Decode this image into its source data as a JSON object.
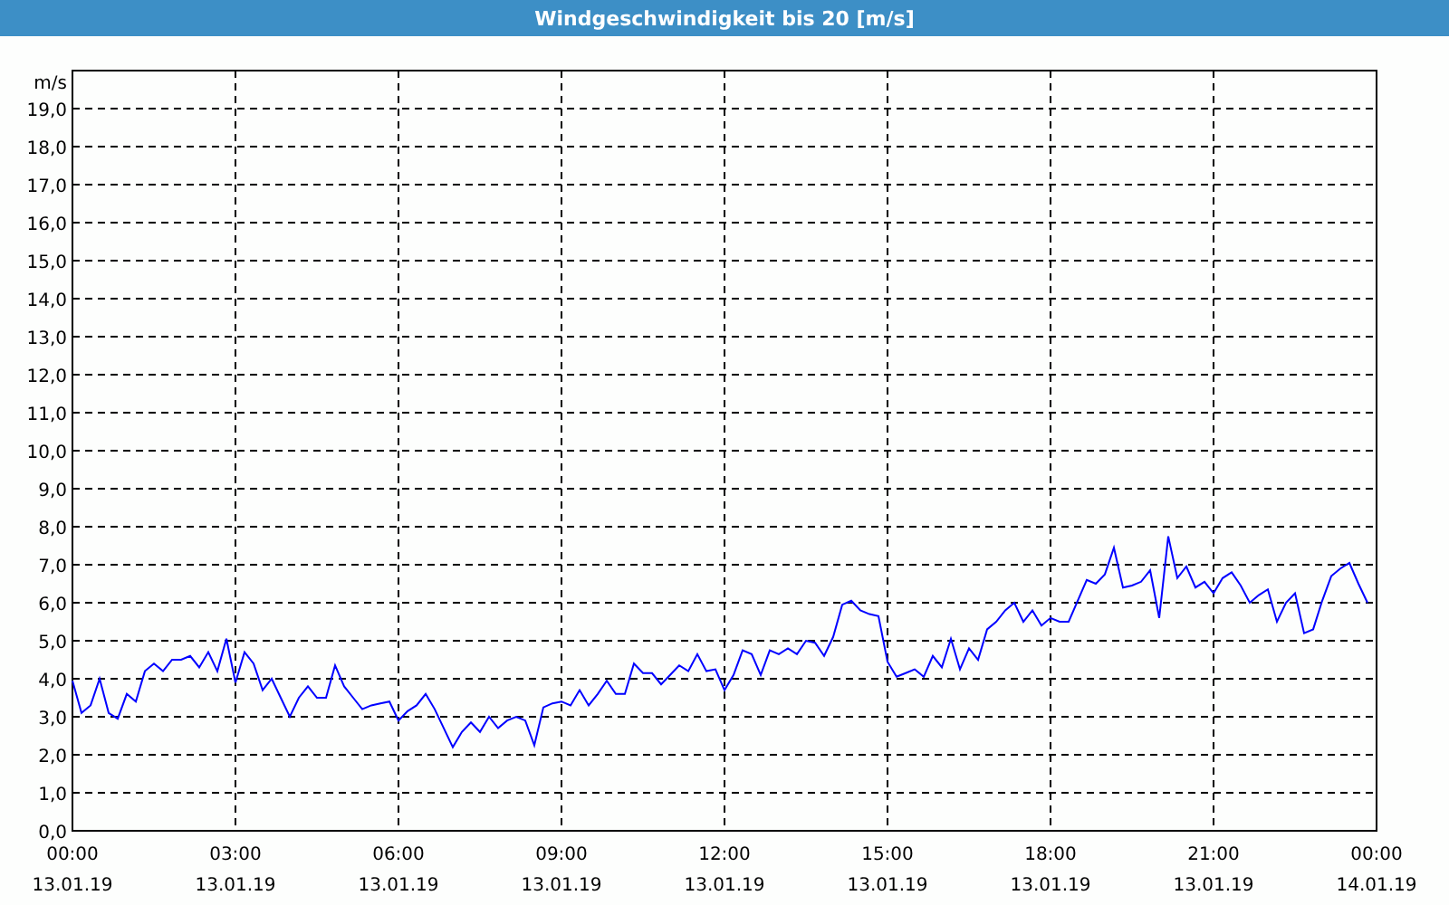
{
  "window": {
    "title": "Windgeschwindigkeit bis 20 [m/s]"
  },
  "chart": {
    "chart_data": {
      "type": "line",
      "grid": true,
      "ylabel": "m/s",
      "ylim": [
        0,
        20
      ],
      "yticks": [
        {
          "value": 0,
          "label": "0,0"
        },
        {
          "value": 1,
          "label": "1,0"
        },
        {
          "value": 2,
          "label": "2,0"
        },
        {
          "value": 3,
          "label": "3,0"
        },
        {
          "value": 4,
          "label": "4,0"
        },
        {
          "value": 5,
          "label": "5,0"
        },
        {
          "value": 6,
          "label": "6,0"
        },
        {
          "value": 7,
          "label": "7,0"
        },
        {
          "value": 8,
          "label": "8,0"
        },
        {
          "value": 9,
          "label": "9,0"
        },
        {
          "value": 10,
          "label": "10,0"
        },
        {
          "value": 11,
          "label": "11,0"
        },
        {
          "value": 12,
          "label": "12,0"
        },
        {
          "value": 13,
          "label": "13,0"
        },
        {
          "value": 14,
          "label": "14,0"
        },
        {
          "value": 15,
          "label": "15,0"
        },
        {
          "value": 16,
          "label": "16,0"
        },
        {
          "value": 17,
          "label": "17,0"
        },
        {
          "value": 18,
          "label": "18,0"
        },
        {
          "value": 19,
          "label": "19,0"
        }
      ],
      "categories": [
        "00:00\n13.01.19",
        null,
        null,
        null,
        null,
        null,
        null,
        null,
        null,
        null,
        null,
        null,
        null,
        null,
        null,
        null,
        null,
        null,
        "03:00\n13.01.19",
        null,
        null,
        null,
        null,
        null,
        null,
        null,
        null,
        null,
        null,
        null,
        null,
        null,
        null,
        null,
        null,
        null,
        "06:00\n13.01.19",
        null,
        null,
        null,
        null,
        null,
        null,
        null,
        null,
        null,
        null,
        null,
        null,
        null,
        null,
        null,
        null,
        null,
        "09:00\n13.01.19",
        null,
        null,
        null,
        null,
        null,
        null,
        null,
        null,
        null,
        null,
        null,
        null,
        null,
        null,
        null,
        null,
        null,
        "12:00\n13.01.19",
        null,
        null,
        null,
        null,
        null,
        null,
        null,
        null,
        null,
        null,
        null,
        null,
        null,
        null,
        null,
        null,
        null,
        "15:00\n13.01.19",
        null,
        null,
        null,
        null,
        null,
        null,
        null,
        null,
        null,
        null,
        null,
        null,
        null,
        null,
        null,
        null,
        null,
        "18:00\n13.01.19",
        null,
        null,
        null,
        null,
        null,
        null,
        null,
        null,
        null,
        null,
        null,
        null,
        null,
        null,
        null,
        null,
        null,
        "21:00\n13.01.19",
        null,
        null,
        null,
        null,
        null,
        null,
        null,
        null,
        null,
        null,
        null,
        null,
        null,
        null,
        null,
        null,
        null,
        "00:00\n14.01.19"
      ],
      "series": [
        {
          "color": "#0000ff",
          "values": [
            3.95,
            3.1,
            3.3,
            4.0,
            3.1,
            2.95,
            3.6,
            3.4,
            4.2,
            4.4,
            4.2,
            4.5,
            4.5,
            4.6,
            4.3,
            4.7,
            4.2,
            5.05,
            3.9,
            4.7,
            4.4,
            3.7,
            4.0,
            3.5,
            3.0,
            3.5,
            3.8,
            3.5,
            3.5,
            4.35,
            3.8,
            3.5,
            3.2,
            3.3,
            3.35,
            3.4,
            2.9,
            3.15,
            3.3,
            3.6,
            3.2,
            2.7,
            2.2,
            2.6,
            2.85,
            2.6,
            3.0,
            2.7,
            2.9,
            3.0,
            2.9,
            2.25,
            3.25,
            3.35,
            3.4,
            3.3,
            3.7,
            3.3,
            3.6,
            3.95,
            3.6,
            3.6,
            4.4,
            4.15,
            4.15,
            3.85,
            4.1,
            4.35,
            4.2,
            4.65,
            4.2,
            4.25,
            3.7,
            4.1,
            4.75,
            4.65,
            4.1,
            4.75,
            4.65,
            4.8,
            4.65,
            5.0,
            4.95,
            4.6,
            5.1,
            5.95,
            6.05,
            5.8,
            5.7,
            5.65,
            4.45,
            4.05,
            4.15,
            4.25,
            4.05,
            4.6,
            4.3,
            5.05,
            4.25,
            4.8,
            4.5,
            5.3,
            5.5,
            5.8,
            6.0,
            5.5,
            5.8,
            5.4,
            5.6,
            5.5,
            5.5,
            6.05,
            6.6,
            6.5,
            6.75,
            7.45,
            6.4,
            6.45,
            6.55,
            6.85,
            5.6,
            7.75,
            6.65,
            6.95,
            6.4,
            6.55,
            6.25,
            6.65,
            6.8,
            6.45,
            6.0,
            6.2,
            6.35,
            5.5,
            6.0,
            6.25,
            5.2,
            5.3,
            6.05,
            6.7,
            6.9,
            7.05,
            6.5,
            6.0,
            null
          ]
        }
      ]
    }
  }
}
